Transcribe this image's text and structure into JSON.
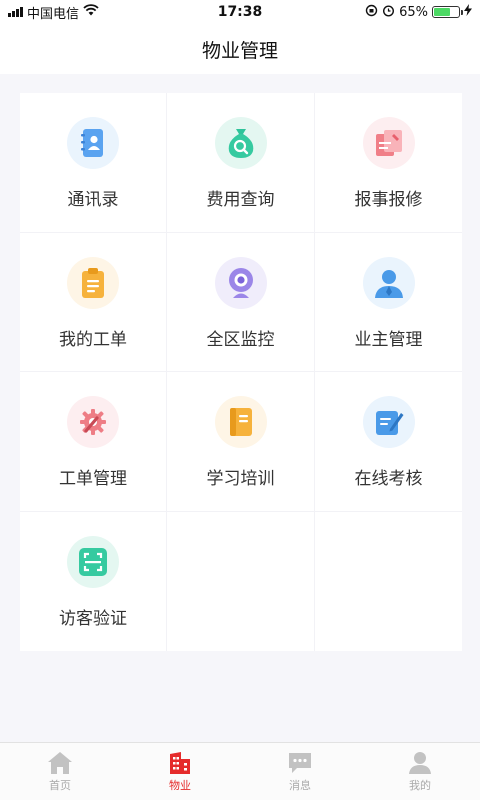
{
  "status_bar": {
    "carrier": "中国电信",
    "time": "17:38",
    "battery": "65%",
    "battery_level": 0.65
  },
  "header": {
    "title": "物业管理"
  },
  "grid": {
    "items": [
      {
        "label": "通讯录",
        "icon": "contacts-book-icon",
        "bg": "#eaf4fd"
      },
      {
        "label": "费用查询",
        "icon": "money-bag-search-icon",
        "bg": "#e4f7f1"
      },
      {
        "label": "报事报修",
        "icon": "report-repair-icon",
        "bg": "#fdeef0"
      },
      {
        "label": "我的工单",
        "icon": "clipboard-icon",
        "bg": "#fef5e6"
      },
      {
        "label": "全区监控",
        "icon": "webcam-icon",
        "bg": "#f0edfb"
      },
      {
        "label": "业主管理",
        "icon": "owner-person-icon",
        "bg": "#eaf4fd"
      },
      {
        "label": "工单管理",
        "icon": "gear-wrench-icon",
        "bg": "#fdeef0"
      },
      {
        "label": "学习培训",
        "icon": "document-book-icon",
        "bg": "#fef5e6"
      },
      {
        "label": "在线考核",
        "icon": "edit-note-icon",
        "bg": "#eaf4fd"
      },
      {
        "label": "访客验证",
        "icon": "scan-code-icon",
        "bg": "#e4f7f1"
      }
    ]
  },
  "tab_bar": {
    "tabs": [
      {
        "label": "首页",
        "icon": "home-icon"
      },
      {
        "label": "物业",
        "icon": "building-icon",
        "active": true
      },
      {
        "label": "消息",
        "icon": "message-bubble-icon"
      },
      {
        "label": "我的",
        "icon": "profile-icon"
      }
    ],
    "active_color": "#e52b2b",
    "inactive_color": "#aaaaaa"
  }
}
